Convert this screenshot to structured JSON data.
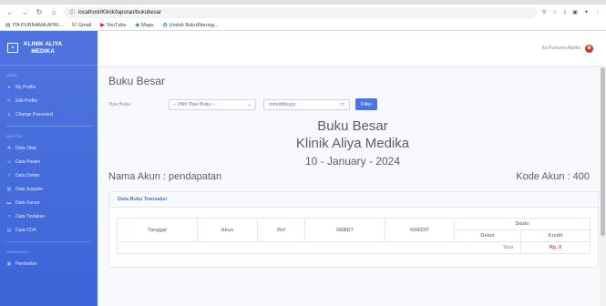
{
  "browser": {
    "url": "localhost/Klinik/laporan/bukubesar",
    "bookmarks": [
      {
        "label": "ITA PURNAMA APRI...",
        "icon": "bookmark-icon"
      },
      {
        "label": "Gmail",
        "icon": "gmail-icon"
      },
      {
        "label": "YouTube",
        "icon": "youtube-icon"
      },
      {
        "label": "Maps",
        "icon": "maps-icon"
      },
      {
        "label": "Unduh BukuWarung...",
        "icon": "bukuwarung-icon"
      }
    ]
  },
  "sidebar": {
    "brand_line1": "KLINIK ALIYA",
    "brand_line2": "MEDIKA",
    "sections": [
      {
        "head": "USER",
        "items": [
          "My Profile",
          "Edit Profile",
          "Change Password"
        ]
      },
      {
        "head": "MASTER",
        "items": [
          "Data Obat",
          "Data Pasien",
          "Data Dokter",
          "Data Supplier",
          "Data Kamar",
          "Data Tindakan",
          "Data COA"
        ]
      },
      {
        "head": "TRANSAKSI",
        "items": [
          "Pembelian"
        ]
      }
    ]
  },
  "topbar": {
    "user_name": "Ita Purnama Aprilia"
  },
  "page": {
    "heading": "Buku Besar",
    "filter_label": "Tipe Buku",
    "select_value": "-- Pilih Tipe Buku --",
    "date_placeholder": "mm/dd/yyyy",
    "filter_button": "Filter",
    "report_title": "Buku Besar",
    "clinic_name": "Klinik Aliya Medika",
    "report_date": "10 - January - 2024",
    "account_name": "Nama Akun : pendapatan",
    "account_code": "Kode Akun : 400",
    "card_title": "Data Buku Transaksi"
  },
  "table": {
    "saldo_header": "Saldo",
    "columns": [
      "Tanggal",
      "Akun",
      "Ref",
      "DEBET",
      "KREDIT"
    ],
    "saldo_columns": [
      "Debet",
      "Kredit"
    ],
    "total_label": "Total",
    "total_value": "Rp. 0"
  },
  "colors": {
    "primary": "#4e73df",
    "danger": "#e74a3b"
  }
}
